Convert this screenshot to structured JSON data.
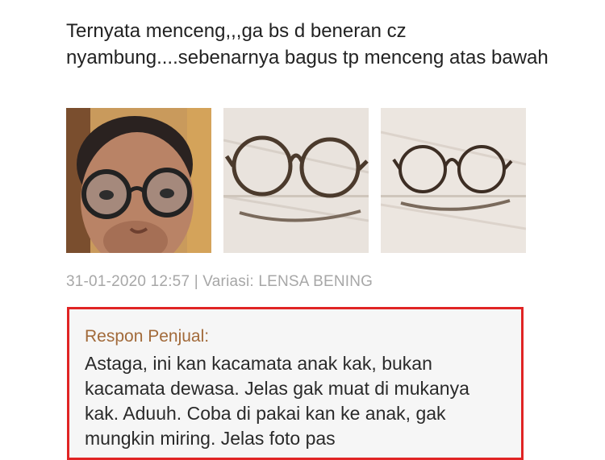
{
  "review": {
    "text": "Ternyata menceng,,,ga bs d beneran cz nyambung....sebenarnya bagus tp menceng atas bawah"
  },
  "photos": [
    {
      "icon": "person-wearing-glasses-photo"
    },
    {
      "icon": "round-glasses-photo"
    },
    {
      "icon": "round-glasses-photo"
    }
  ],
  "meta": {
    "text": "31-01-2020 12:57 | Variasi: LENSA BENING"
  },
  "seller_response": {
    "title": "Respon Penjual:",
    "text": "Astaga, ini kan kacamata anak kak, bukan kacamata dewasa. Jelas gak muat di mukanya kak. Aduuh. Coba di pakai kan ke anak, gak mungkin miring. Jelas foto pas"
  },
  "colors": {
    "highlight_border": "#e02424",
    "seller_title": "#a26a3a",
    "meta_text": "#a7a7a7"
  }
}
